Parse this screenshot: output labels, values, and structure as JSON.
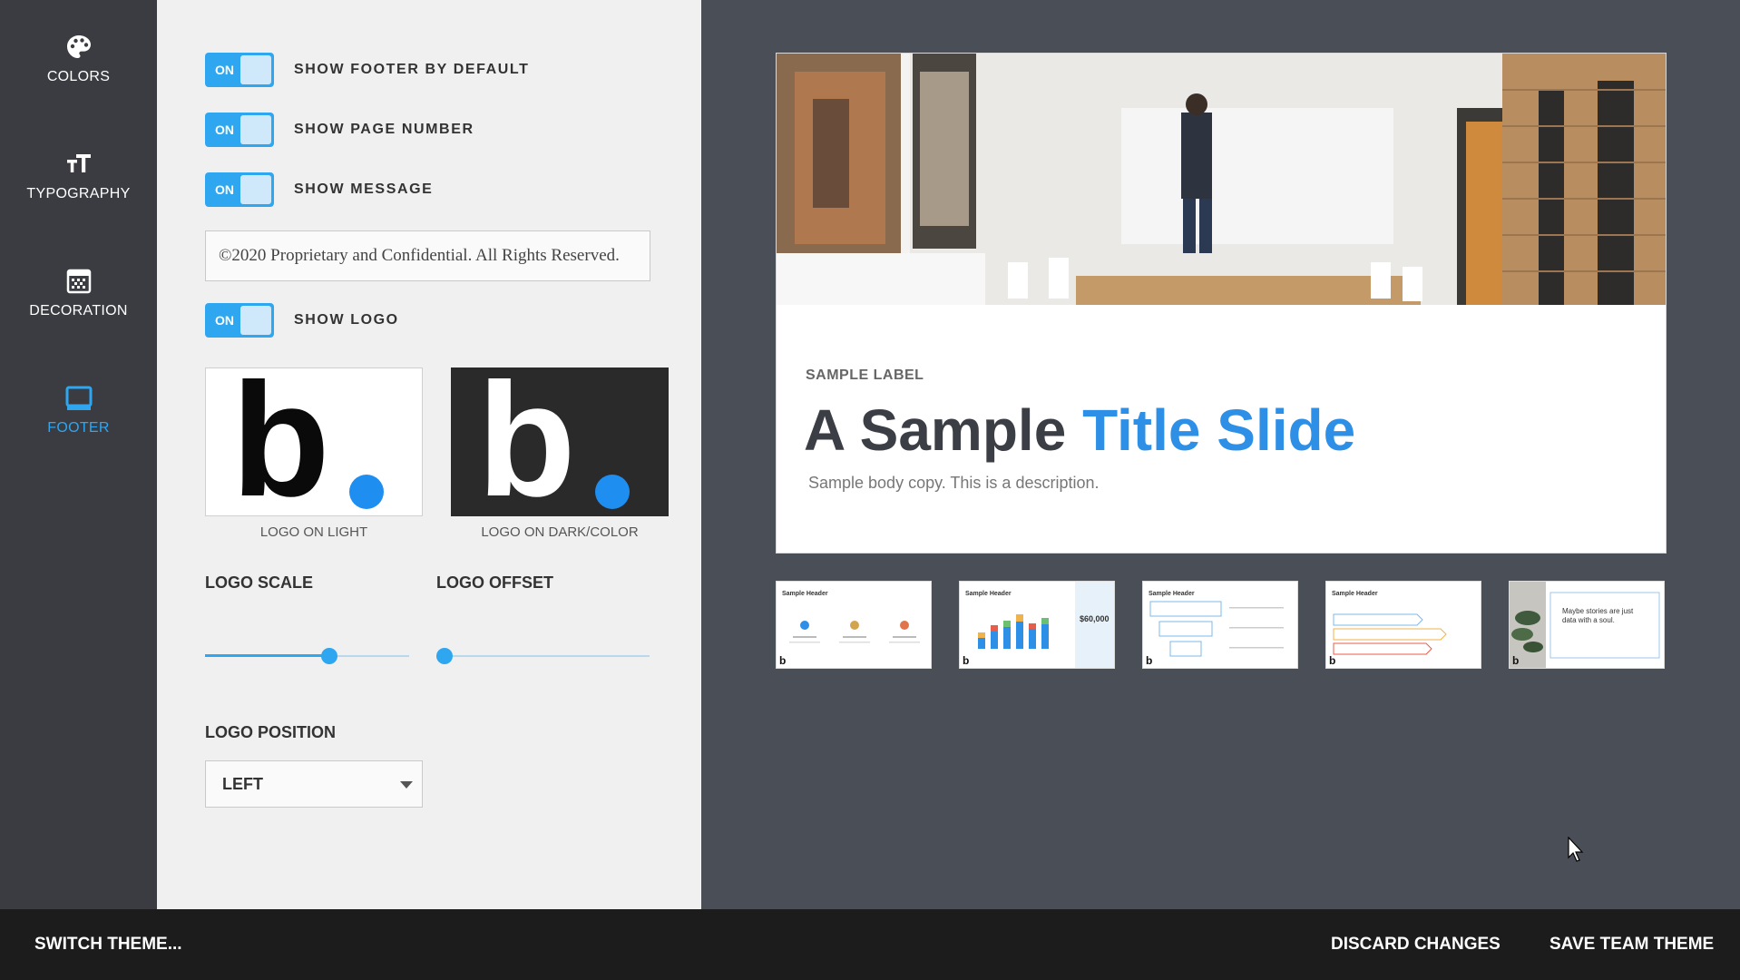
{
  "nav": {
    "items": [
      {
        "label": "COLORS",
        "icon": "palette-icon"
      },
      {
        "label": "TYPOGRAPHY",
        "icon": "text-size-icon"
      },
      {
        "label": "DECORATION",
        "icon": "decoration-icon"
      },
      {
        "label": "FOOTER",
        "icon": "footer-icon",
        "active": true
      }
    ]
  },
  "footer_settings": {
    "toggles": [
      {
        "state": "ON",
        "label": "SHOW FOOTER BY DEFAULT"
      },
      {
        "state": "ON",
        "label": "SHOW PAGE NUMBER"
      },
      {
        "state": "ON",
        "label": "SHOW MESSAGE"
      },
      {
        "state": "ON",
        "label": "SHOW LOGO"
      }
    ],
    "message_value": "©2020 Proprietary and Confidential. All Rights Reserved.",
    "logo_light": {
      "letter": "b",
      "caption": "LOGO ON LIGHT"
    },
    "logo_dark": {
      "letter": "b",
      "caption": "LOGO ON DARK/COLOR"
    },
    "logo_scale": {
      "label": "LOGO SCALE",
      "value_fraction": 0.61
    },
    "logo_offset": {
      "label": "LOGO OFFSET",
      "value_fraction": 0.0
    },
    "logo_position": {
      "label": "LOGO POSITION",
      "value": "LEFT"
    }
  },
  "preview": {
    "label": "SAMPLE LABEL",
    "title_dark": "A Sample",
    "title_accent": "Title Slide",
    "body": "Sample body copy. This is a description.",
    "thumbnails": [
      {
        "header": "Sample Header"
      },
      {
        "header": "Sample Header",
        "value": "$60,000"
      },
      {
        "header": "Sample Header"
      },
      {
        "header": "Sample Header"
      },
      {
        "quote": "Maybe stories are just data with a soul."
      }
    ]
  },
  "bottom_bar": {
    "switch_label": "SWITCH THEME...",
    "discard_label": "DISCARD CHANGES",
    "save_label": "SAVE TEAM THEME"
  },
  "colors": {
    "accent": "#2ea6f0",
    "title_accent": "#2e8fe6",
    "nav_bg": "#3a3c42",
    "panel_bg": "#f0f0f1",
    "preview_bg": "#4a4e57",
    "bottom_bar_bg": "#1c1c1c"
  }
}
